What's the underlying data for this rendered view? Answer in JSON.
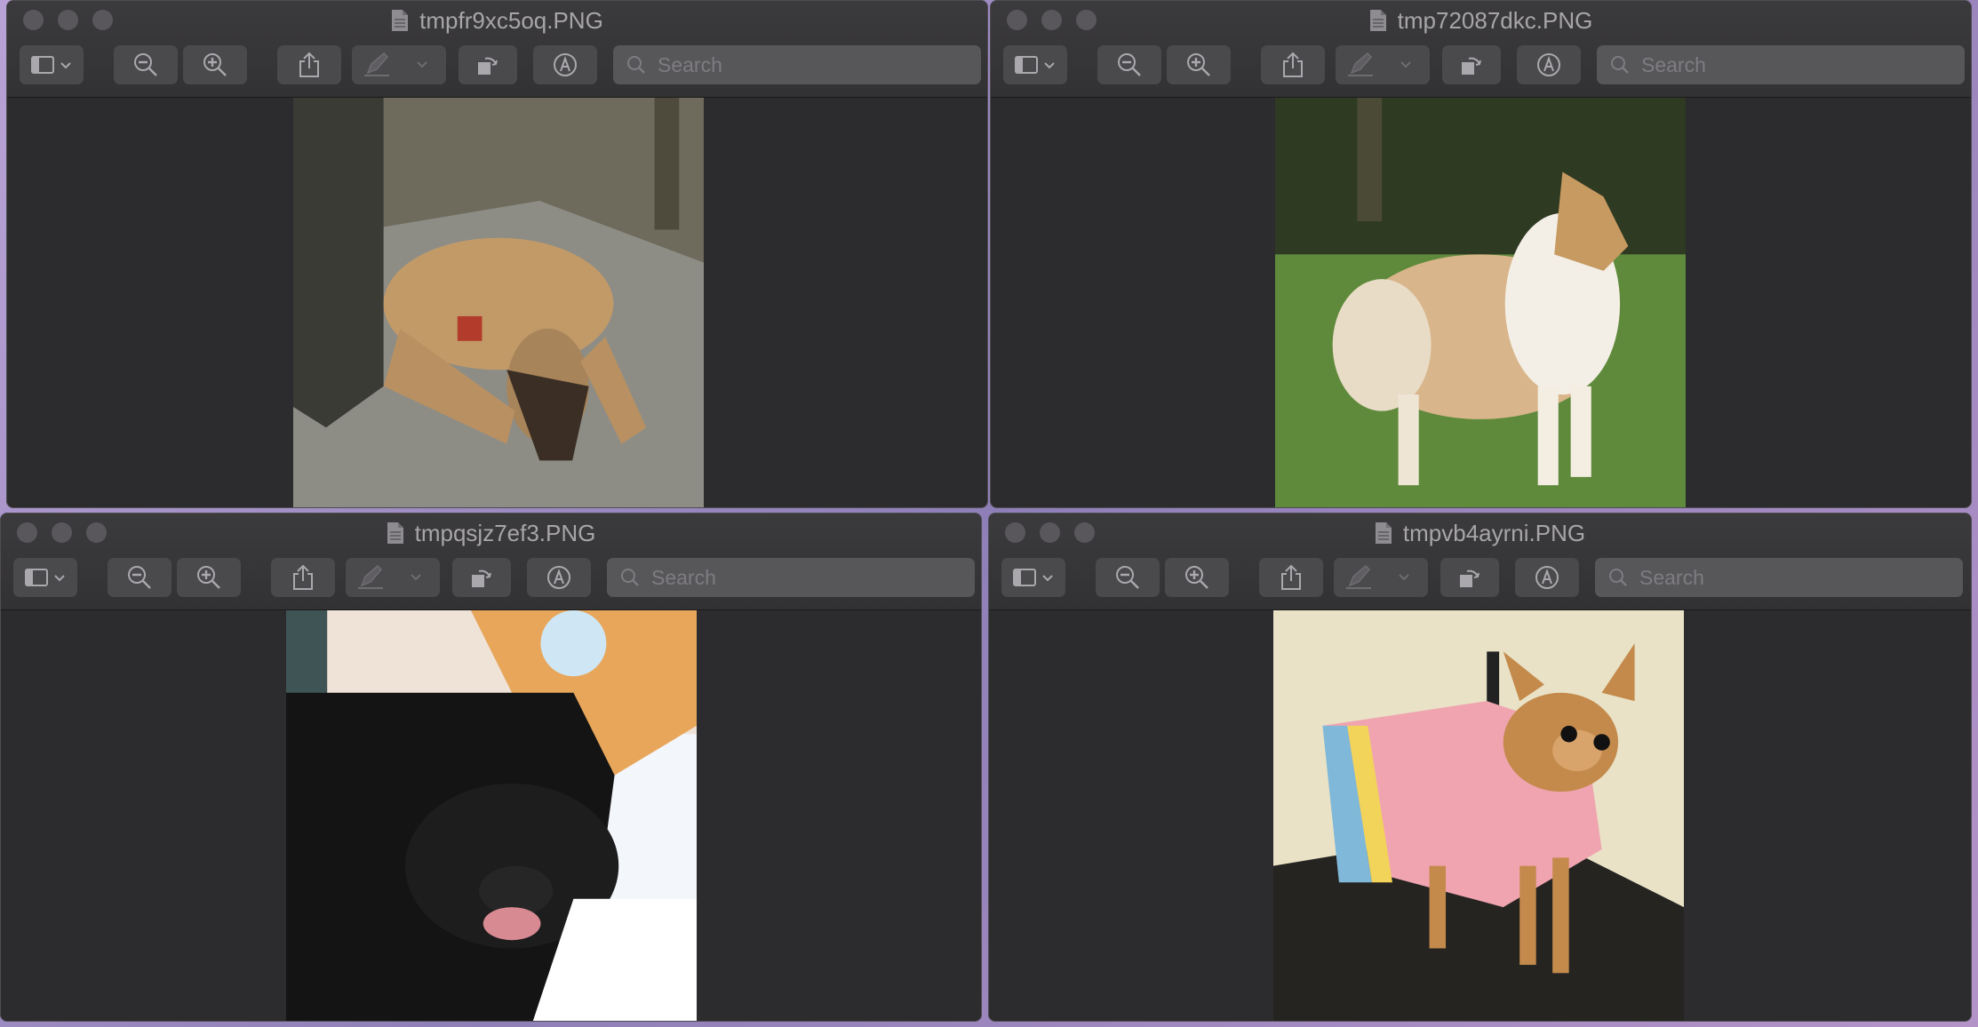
{
  "windows": [
    {
      "title": "tmpfr9xc5oq.PNG",
      "search_placeholder": "Search",
      "image": "dog-lying-on-pavement"
    },
    {
      "title": "tmp72087dkc.PNG",
      "search_placeholder": "Search",
      "image": "collie-standing-on-grass"
    },
    {
      "title": "tmpqsjz7ef3.PNG",
      "search_placeholder": "Search",
      "image": "black-dog-in-snow"
    },
    {
      "title": "tmpvb4ayrni.PNG",
      "search_placeholder": "Search",
      "image": "chihuahua-in-dress"
    }
  ],
  "toolbar_icons": [
    "sidebar-icon",
    "zoom-out-icon",
    "zoom-in-icon",
    "share-icon",
    "markup-pen-icon",
    "rotate-icon",
    "annotate-icon",
    "search-icon"
  ],
  "colors": {
    "window_bg": "#2c2b2d",
    "toolbar_button": "#4a494c",
    "title_text": "#a7a5a8",
    "desktop": "#a18ec6"
  }
}
